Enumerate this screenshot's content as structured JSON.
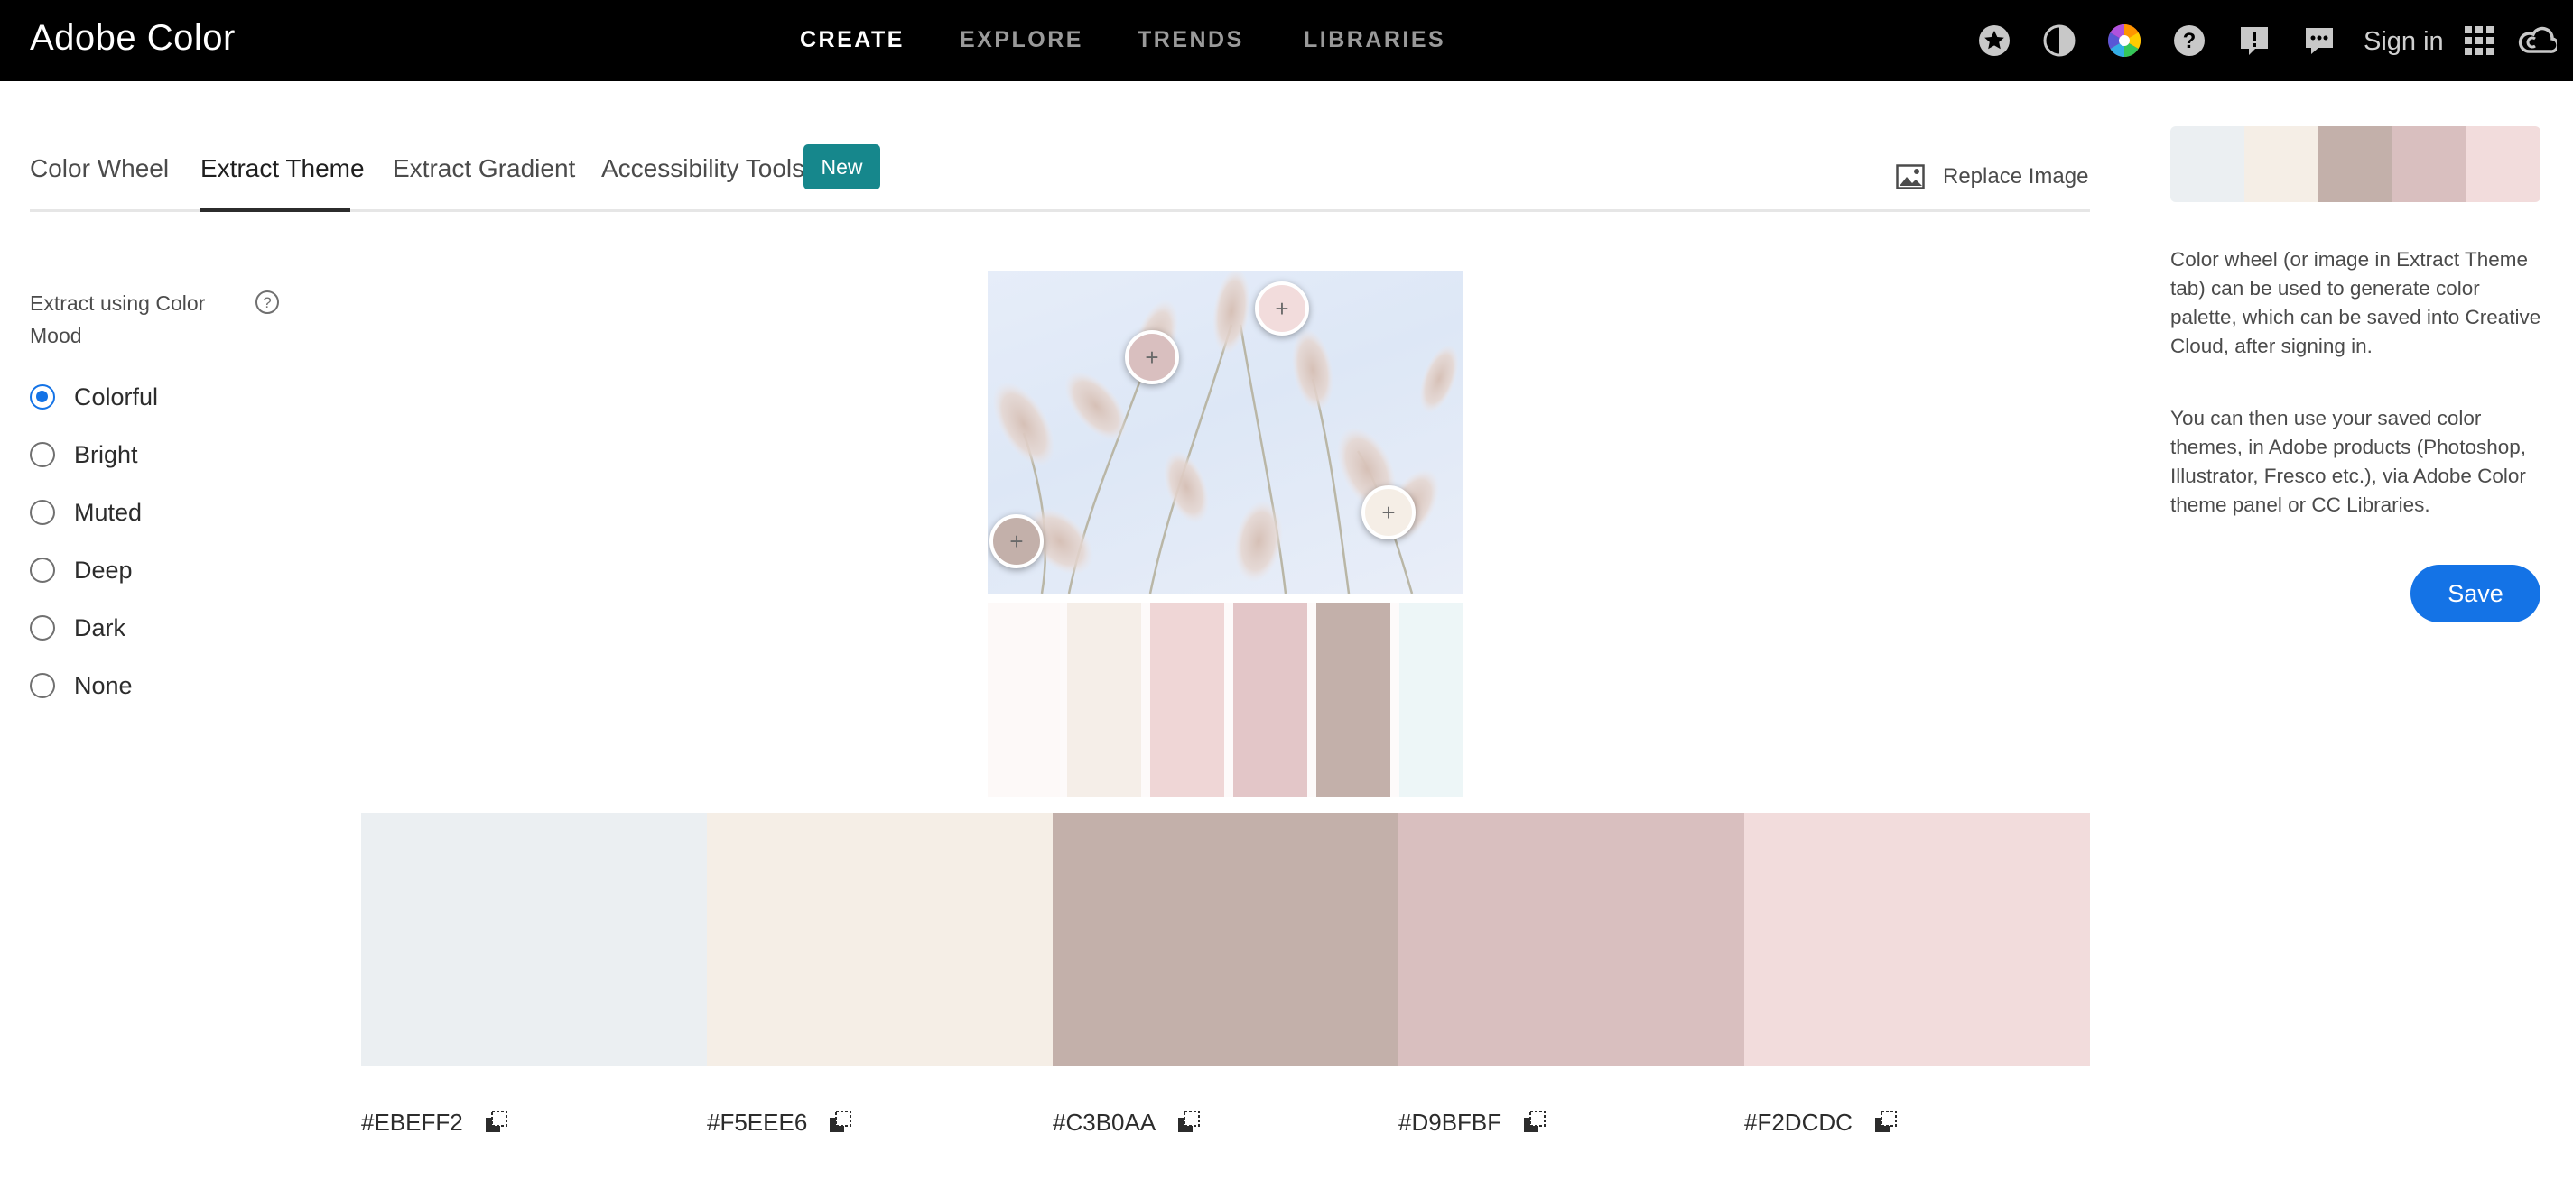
{
  "app": {
    "title": "Adobe Color"
  },
  "nav": {
    "items": [
      {
        "label": "CREATE",
        "active": true
      },
      {
        "label": "EXPLORE",
        "active": false
      },
      {
        "label": "TRENDS",
        "active": false
      },
      {
        "label": "LIBRARIES",
        "active": false
      }
    ],
    "icons": [
      "star-icon",
      "contrast-icon",
      "color-wheel-icon",
      "help-icon",
      "alert-icon",
      "feedback-icon",
      "apps-grid-icon",
      "creative-cloud-icon"
    ],
    "signin_label": "Sign in"
  },
  "tabs": {
    "items": [
      {
        "label": "Color Wheel",
        "active": false
      },
      {
        "label": "Extract Theme",
        "active": true
      },
      {
        "label": "Extract Gradient",
        "active": false
      },
      {
        "label": "Accessibility Tools",
        "active": false
      }
    ],
    "new_badge": "New",
    "replace_image_label": "Replace Image"
  },
  "mood": {
    "title": "Extract using Color Mood",
    "options": [
      {
        "label": "Colorful",
        "selected": true
      },
      {
        "label": "Bright",
        "selected": false
      },
      {
        "label": "Muted",
        "selected": false
      },
      {
        "label": "Deep",
        "selected": false
      },
      {
        "label": "Dark",
        "selected": false
      },
      {
        "label": "None",
        "selected": false
      }
    ]
  },
  "image": {
    "picker_colors": [
      "#F2DCDC",
      "#D9BFBF",
      "#F5EEE6",
      "#C3B0AA"
    ],
    "strip_colors": [
      "#FDF9F8",
      "#F5EEE8",
      "#EFD6D6",
      "#E3C6C8",
      "#C3B0AA",
      "#EDF6F7"
    ]
  },
  "palette": {
    "swatches": [
      {
        "hex": "#EBEFF2"
      },
      {
        "hex": "#F5EEE6"
      },
      {
        "hex": "#C3B0AA"
      },
      {
        "hex": "#D9BFBF"
      },
      {
        "hex": "#F2DCDC"
      }
    ]
  },
  "info": {
    "paragraph1": "Color wheel (or image in Extract Theme tab) can be used to generate color palette, which can be saved into Creative Cloud, after signing in.",
    "paragraph2": "You can then use your saved color themes, in Adobe products (Photoshop, Illustrator, Fresco etc.), via Adobe Color theme panel or CC Libraries.",
    "save_label": "Save"
  },
  "colors": {
    "accent": "#1473E6",
    "badge": "#16878C",
    "topbar": "#000000"
  }
}
